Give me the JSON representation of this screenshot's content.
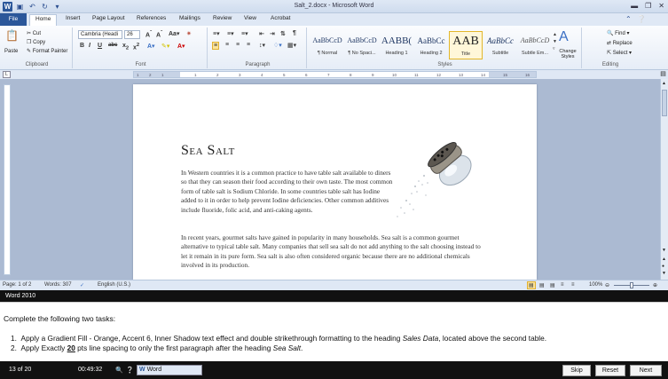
{
  "window": {
    "title": "Salt_2.docx - Microsoft Word"
  },
  "tabs": [
    "File",
    "Home",
    "Insert",
    "Page Layout",
    "References",
    "Mailings",
    "Review",
    "View",
    "Acrobat"
  ],
  "clipboard": {
    "paste": "Paste",
    "cut": "Cut",
    "copy": "Copy",
    "format_painter": "Format Painter",
    "label": "Clipboard"
  },
  "font": {
    "name": "Cambria (Headi",
    "size": "26",
    "label": "Font"
  },
  "paragraph": {
    "label": "Paragraph"
  },
  "styles": {
    "items": [
      {
        "sample": "AaBbCcD",
        "name": "¶ Normal"
      },
      {
        "sample": "AaBbCcD",
        "name": "¶ No Spaci..."
      },
      {
        "sample": "AABB(",
        "name": "Heading 1"
      },
      {
        "sample": "AaBbCc",
        "name": "Heading 2"
      },
      {
        "sample": "AAB",
        "name": "Title"
      },
      {
        "sample": "AaBbCc",
        "name": "Subtitle"
      },
      {
        "sample": "AaBbCcD",
        "name": "Subtle Em..."
      }
    ],
    "change_styles": "Change Styles",
    "label": "Styles"
  },
  "editing": {
    "find": "Find",
    "replace": "Replace",
    "select": "Select",
    "label": "Editing"
  },
  "document": {
    "heading": "Sea Salt",
    "para1": "In Western countries it is a common practice to have table salt available to diners so that they can season their food according to their own taste. The most common form of table salt is Sodium Chloride. In some countries table salt has Iodine added to it in order to help prevent Iodine deficiencies. Other common additives include fluoride, folic acid, and anti-caking agents.",
    "para2": "In recent years, gourmet salts have gained in popularity in many households. Sea salt is a common gourmet alternative to typical table salt. Many companies that sell sea salt do not add anything to the salt choosing instead to let it remain in its pure form. Sea salt is also often considered organic because there are no additional chemicals involved in its production."
  },
  "status": {
    "page": "Page: 1 of 2",
    "words": "Words: 307",
    "language": "English (U.S.)",
    "zoom": "100%"
  },
  "task_panel": {
    "header": "Word 2010",
    "intro": "Complete the following two tasks:",
    "task1_prefix": "Apply a Gradient Fill - Orange, Accent 6, Inner Shadow text effect and double strikethrough formatting to the heading ",
    "task1_em": "Sales Data",
    "task1_suffix": ", located above the second table.",
    "task2_prefix": "Apply Exactly ",
    "task2_strong": "20",
    "task2_mid": " pts line spacing to only the first paragraph after the heading ",
    "task2_em": "Sea Salt",
    "task2_suffix": "."
  },
  "footer": {
    "progress": "13 of 20",
    "timer": "00:49:32",
    "app": "Word",
    "skip": "Skip",
    "reset": "Reset",
    "next": "Next"
  }
}
